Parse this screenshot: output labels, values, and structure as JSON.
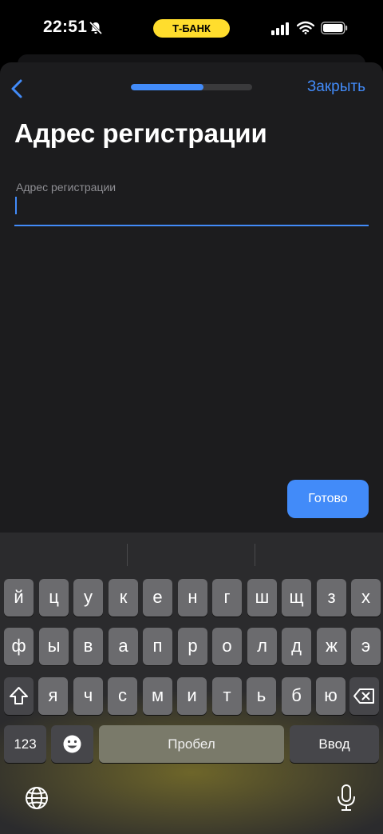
{
  "status_bar": {
    "time": "22:51",
    "brand": "Т-БАНК"
  },
  "nav": {
    "close_label": "Закрыть",
    "progress_fraction": 0.6
  },
  "page": {
    "title": "Адрес регистрации",
    "field_label": "Адрес регистрации",
    "field_value": ""
  },
  "actions": {
    "done_label": "Готово"
  },
  "keyboard": {
    "row1": [
      "й",
      "ц",
      "у",
      "к",
      "е",
      "н",
      "г",
      "ш",
      "щ",
      "з",
      "х"
    ],
    "row2": [
      "ф",
      "ы",
      "в",
      "а",
      "п",
      "р",
      "о",
      "л",
      "д",
      "ж",
      "э"
    ],
    "row3": [
      "я",
      "ч",
      "с",
      "м",
      "и",
      "т",
      "ь",
      "б",
      "ю"
    ],
    "numbers_label": "123",
    "space_label": "Пробел",
    "return_label": "Ввод",
    "icons": [
      "shift-icon",
      "backspace-icon",
      "emoji-icon",
      "globe-icon",
      "microphone-icon"
    ]
  },
  "colors": {
    "accent": "#428bf9",
    "brand_yellow": "#ffdd2d",
    "sheet_bg": "#1c1c1e"
  }
}
